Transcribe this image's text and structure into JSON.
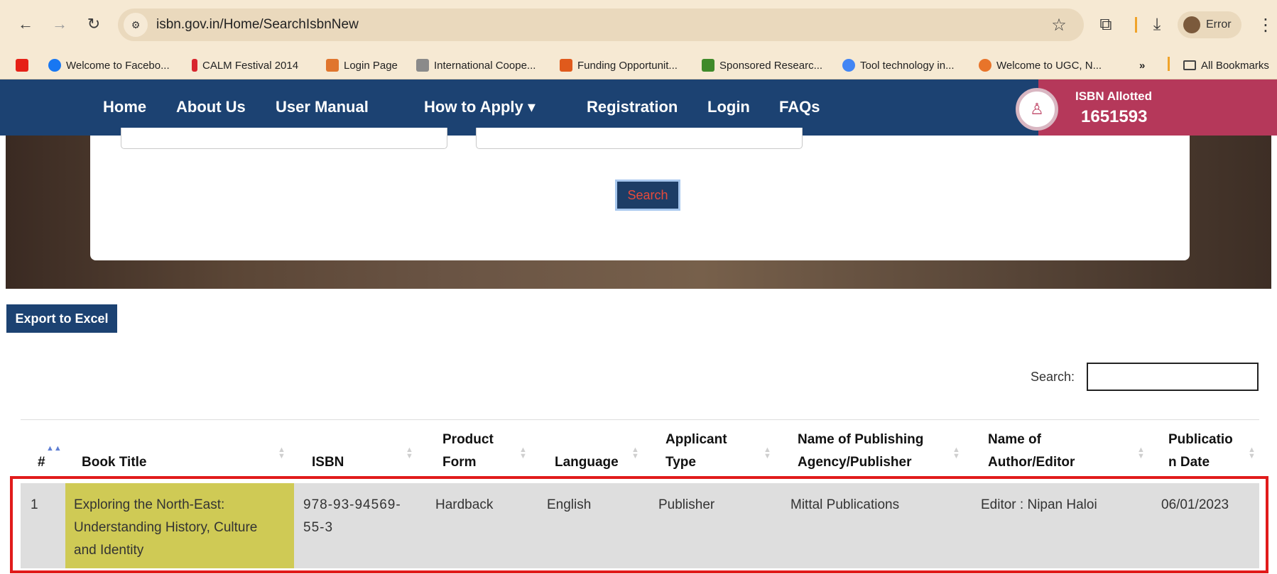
{
  "browser": {
    "url": "isbn.gov.in/Home/SearchIsbnNew",
    "profile_label": "Error",
    "bookmarks": [
      {
        "label": "",
        "color": "#e62117"
      },
      {
        "label": "Welcome to Facebo...",
        "color": "#1877f2"
      },
      {
        "label": "CALM Festival 2014",
        "color": "#d8262e"
      },
      {
        "label": "Login Page",
        "color": "#e0752d"
      },
      {
        "label": "International Coope...",
        "color": "#8a8a8a"
      },
      {
        "label": "Funding Opportunit...",
        "color": "#e05a1c"
      },
      {
        "label": "Sponsored Researc...",
        "color": "#3f8a2a"
      },
      {
        "label": "Tool technology in...",
        "color": "#4285f4"
      },
      {
        "label": "Welcome to UGC, N...",
        "color": "#e8742a"
      }
    ],
    "more_label": "»",
    "all_bookmarks_label": "All Bookmarks"
  },
  "site_nav": {
    "links": [
      "Home",
      "About Us",
      "User Manual",
      "How to Apply ▾",
      "Registration",
      "Login",
      "FAQs"
    ],
    "isbn_label": "ISBN Allotted",
    "isbn_count": "1651593"
  },
  "filters": {
    "search_button": "Search"
  },
  "table": {
    "export_label": "Export to Excel",
    "search_label": "Search:",
    "search_value": "",
    "columns": [
      {
        "line1": "",
        "line2": "#"
      },
      {
        "line1": "",
        "line2": "Book Title"
      },
      {
        "line1": "",
        "line2": "ISBN"
      },
      {
        "line1": "Product",
        "line2": "Form"
      },
      {
        "line1": "",
        "line2": "Language"
      },
      {
        "line1": "Applicant",
        "line2": "Type"
      },
      {
        "line1": "Name of Publishing",
        "line2": "Agency/Publisher"
      },
      {
        "line1": "Name of",
        "line2": "Author/Editor"
      },
      {
        "line1": "Publicatio",
        "line2": "n Date"
      }
    ],
    "rows": [
      {
        "index": "1",
        "title_lines": [
          "Exploring the North-East:",
          "Understanding History, Culture",
          "and Identity"
        ],
        "isbn_lines": [
          "978-93-94569-",
          "55-3"
        ],
        "product_form": "Hardback",
        "language": "English",
        "applicant_type": "Publisher",
        "publisher": "Mittal Publications",
        "author_editor": "Editor : Nipan Haloi",
        "publication_date": "06/01/2023"
      }
    ]
  }
}
